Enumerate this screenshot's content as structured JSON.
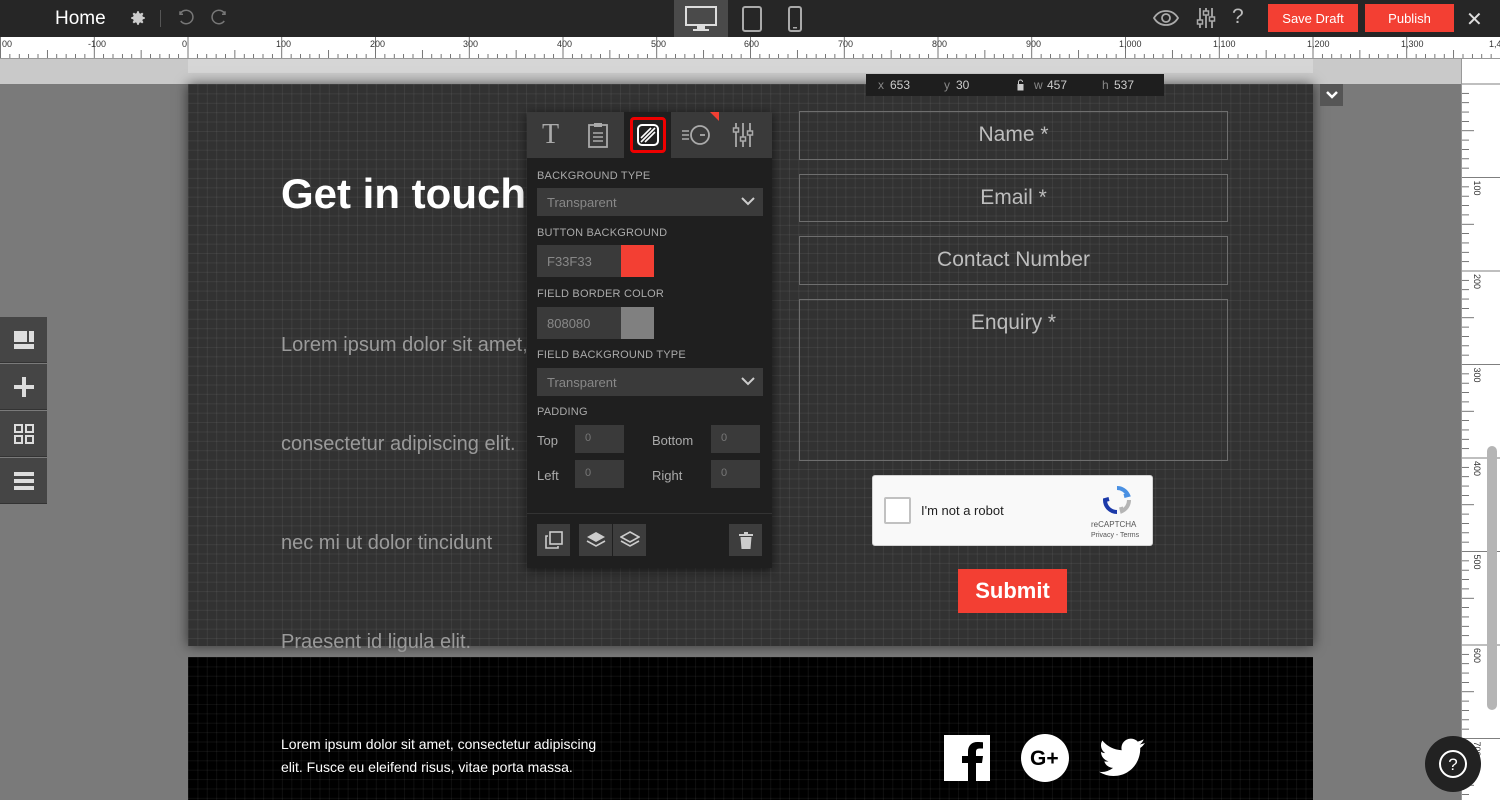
{
  "topbar": {
    "page_name": "Home",
    "save_draft": "Save Draft",
    "publish": "Publish",
    "help": "?",
    "close": "✕",
    "icons": [
      "gear-icon",
      "undo-icon",
      "redo-icon",
      "desktop-icon",
      "tablet-icon",
      "phone-icon",
      "eye-icon",
      "sliders-icon",
      "close-icon"
    ]
  },
  "ruler": {
    "top_ticks": [
      "00",
      "-100",
      "0",
      "100",
      "200",
      "300",
      "400",
      "500",
      "600",
      "700",
      "800",
      "900",
      "1,000",
      "1,100",
      "1,200",
      "1,300",
      "1,4"
    ],
    "side_ticks": [
      "100",
      "200",
      "300",
      "400",
      "500",
      "600",
      "700"
    ]
  },
  "coords": {
    "x_label": "x",
    "x": "653",
    "y_label": "y",
    "y": "30",
    "w_label": "w",
    "w": "457",
    "h_label": "h",
    "h": "537"
  },
  "section": {
    "heading": "Get in touch",
    "paragraph_lines": [
      "Lorem ipsum dolor sit amet,",
      "consectetur adipiscing elit.",
      "nec mi ut dolor tincidunt",
      "Praesent id ligula elit."
    ]
  },
  "form": {
    "name": "Name *",
    "email": "Email *",
    "contact": "Contact Number",
    "enquiry": "Enquiry *",
    "recaptcha_label": "I'm not a robot",
    "recaptcha_brand": "reCAPTCHA",
    "recaptcha_links": "Privacy - Terms",
    "submit": "Submit"
  },
  "panel": {
    "background_type_label": "BACKGROUND TYPE",
    "background_type_value": "Transparent",
    "button_background_label": "BUTTON BACKGROUND",
    "button_background_value": "F33F33",
    "field_border_label": "FIELD BORDER COLOR",
    "field_border_value": "808080",
    "field_bg_type_label": "FIELD BACKGROUND TYPE",
    "field_bg_type_value": "Transparent",
    "padding_label": "PADDING",
    "top_label": "Top",
    "top_value": "0",
    "bottom_label": "Bottom",
    "bottom_value": "0",
    "left_label": "Left",
    "left_value": "0",
    "right_label": "Right",
    "right_value": "0",
    "tab_text": "T",
    "colors": {
      "button_bg": "#f33f33",
      "field_border": "#808080",
      "active_tab_ring": "#e00000"
    }
  },
  "footer": {
    "text": "Lorem ipsum dolor sit amet, consectetur adipiscing elit. Fusce eu eleifend risus, vitae porta massa."
  },
  "colors": {
    "accent": "#f33f33",
    "topbar": "#262626",
    "section_bg": "#323232"
  }
}
